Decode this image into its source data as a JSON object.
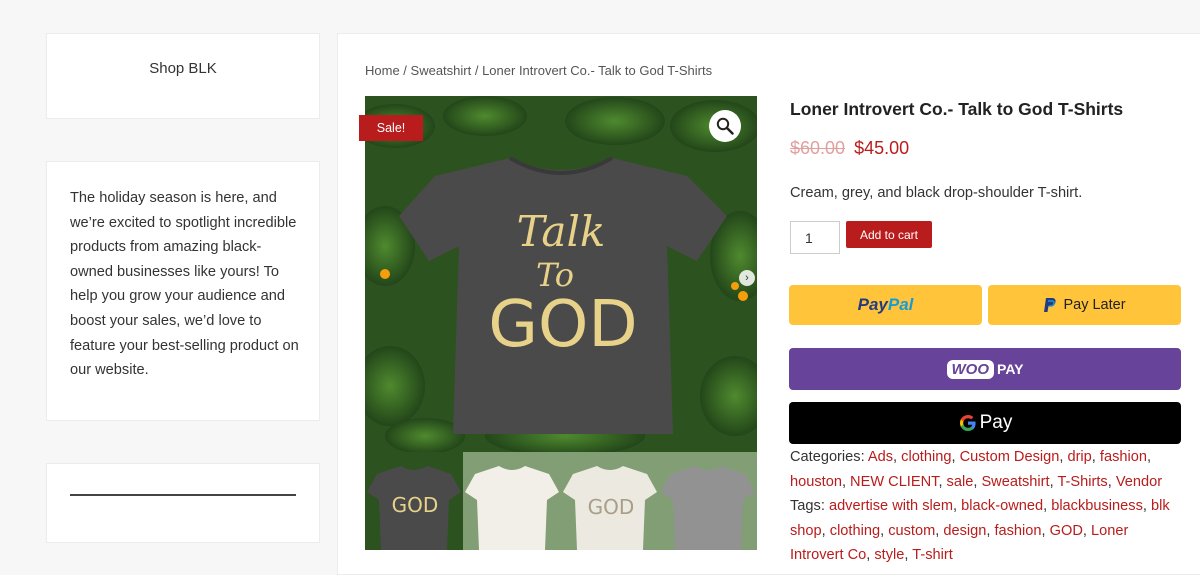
{
  "sidebar": {
    "shop_title": "Shop BLK",
    "promo_text": "The holiday season is here, and we’re excited to spotlight incredible products from amazing black-owned businesses like yours! To help you grow your audience and boost your sales, we’d love to feature your best-selling product on our website."
  },
  "breadcrumb": {
    "home": "Home",
    "sep1": " / ",
    "category": "Sweatshirt",
    "sep2": " / ",
    "current": "Loner Introvert Co.- Talk to God T-Shirts"
  },
  "gallery": {
    "sale_badge": "Sale!",
    "shirt_line1": "Talk",
    "shirt_line2": "To",
    "shirt_line3": "GOD"
  },
  "product": {
    "title": "Loner Introvert Co.- Talk to God T-Shirts",
    "old_price": "$60.00",
    "new_price": "$45.00",
    "description": "Cream, grey, and black drop-shoulder T-shirt.",
    "quantity": "1",
    "add_to_cart": "Add to cart"
  },
  "payments": {
    "paypal_a": "Pay",
    "paypal_b": "Pal",
    "paylater": "Pay Later",
    "woo": "WOO",
    "woopay": "PAY",
    "gpay": "Pay"
  },
  "meta": {
    "categories_label": "Categories:",
    "categories": [
      "Ads",
      "clothing",
      "Custom Design",
      "drip",
      "fashion",
      "houston",
      "NEW CLIENT",
      "sale",
      "Sweatshirt",
      "T-Shirts",
      "Vendor"
    ],
    "tags_label": "Tags:",
    "tags": [
      "advertise with slem",
      "black-owned",
      "blackbusiness",
      "blk shop",
      "clothing",
      "custom",
      "design",
      "fashion",
      "GOD",
      "Loner Introvert Co",
      "style",
      "T-shirt"
    ]
  },
  "colors": {
    "accent": "#b91c1c",
    "paypal": "#ffc439",
    "woopay": "#674399"
  }
}
